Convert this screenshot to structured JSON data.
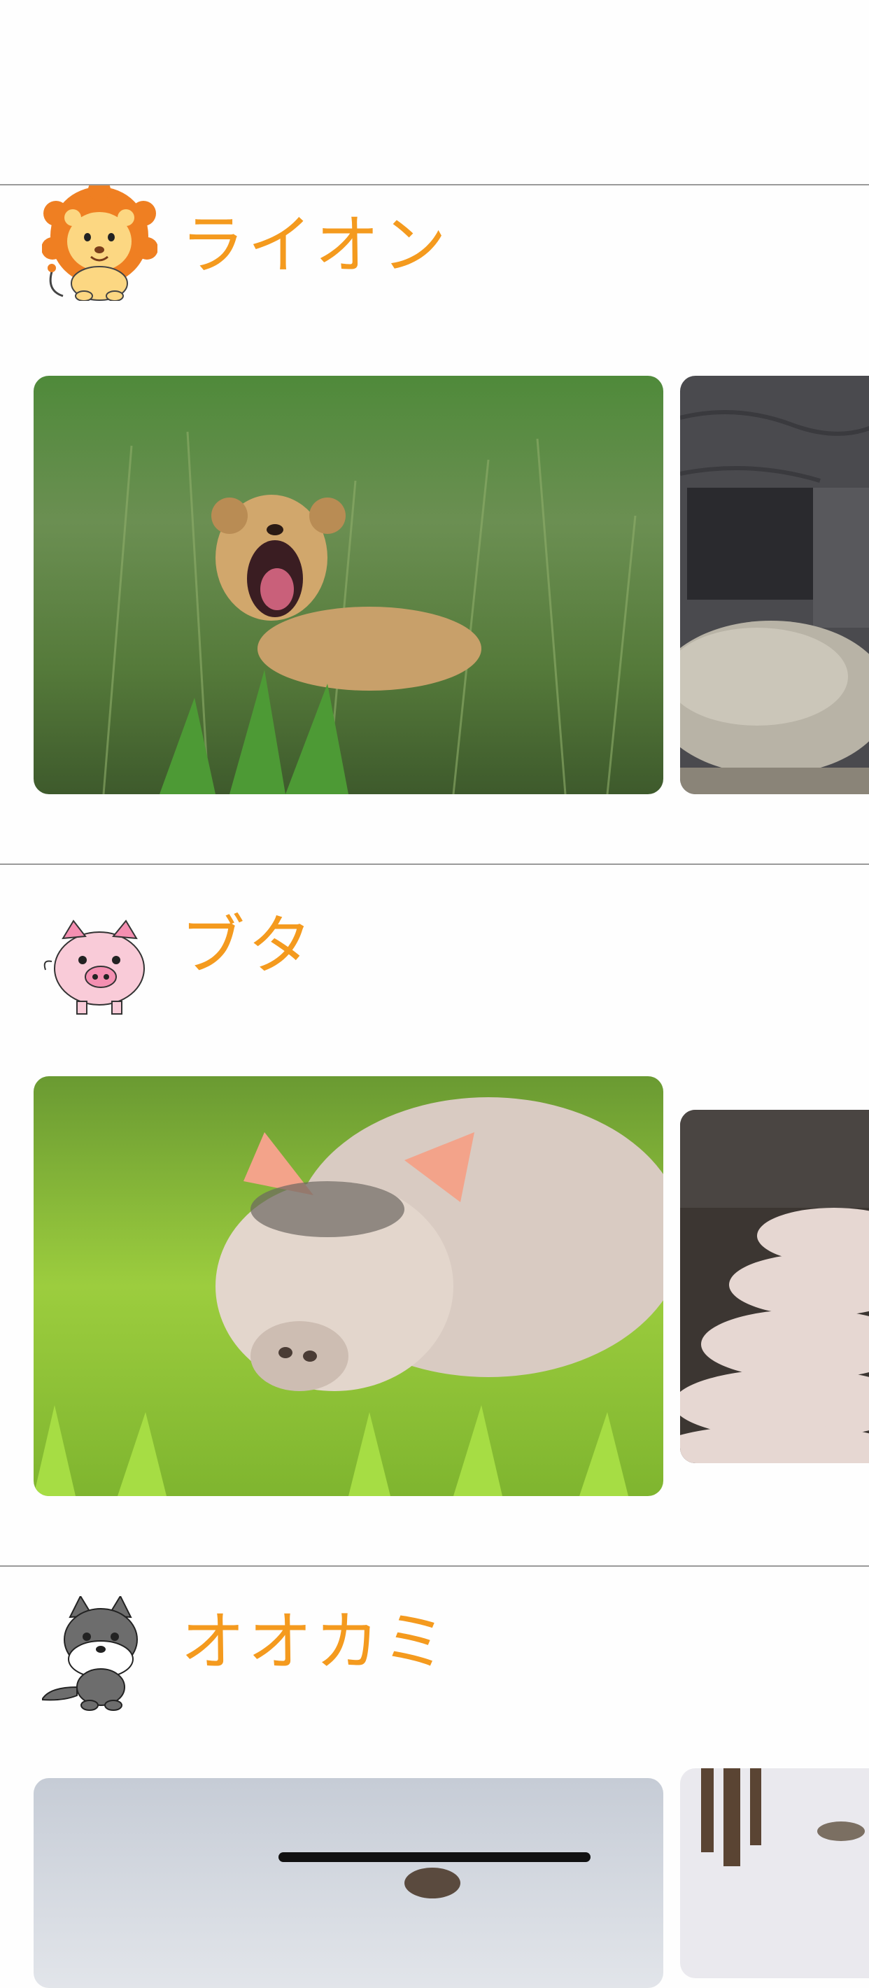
{
  "sections": [
    {
      "id": "lion",
      "title": "ライオン",
      "icon": "lion-cartoon-icon",
      "photos": [
        "lion-cub-roaring-photo",
        "lion-enclosure-rock-photo"
      ]
    },
    {
      "id": "pig",
      "title": "ブタ",
      "icon": "pig-cartoon-icon",
      "photos": [
        "pig-on-grass-photo",
        "piglets-photo"
      ]
    },
    {
      "id": "wolf",
      "title": "オオカミ",
      "icon": "wolf-cartoon-icon",
      "photos": [
        "wolf-sky-photo",
        "wolf-snow-forest-photo"
      ]
    }
  ],
  "colors": {
    "accent": "#f49a1e",
    "divider": "#9a9a9a",
    "background": "#fefefe"
  }
}
